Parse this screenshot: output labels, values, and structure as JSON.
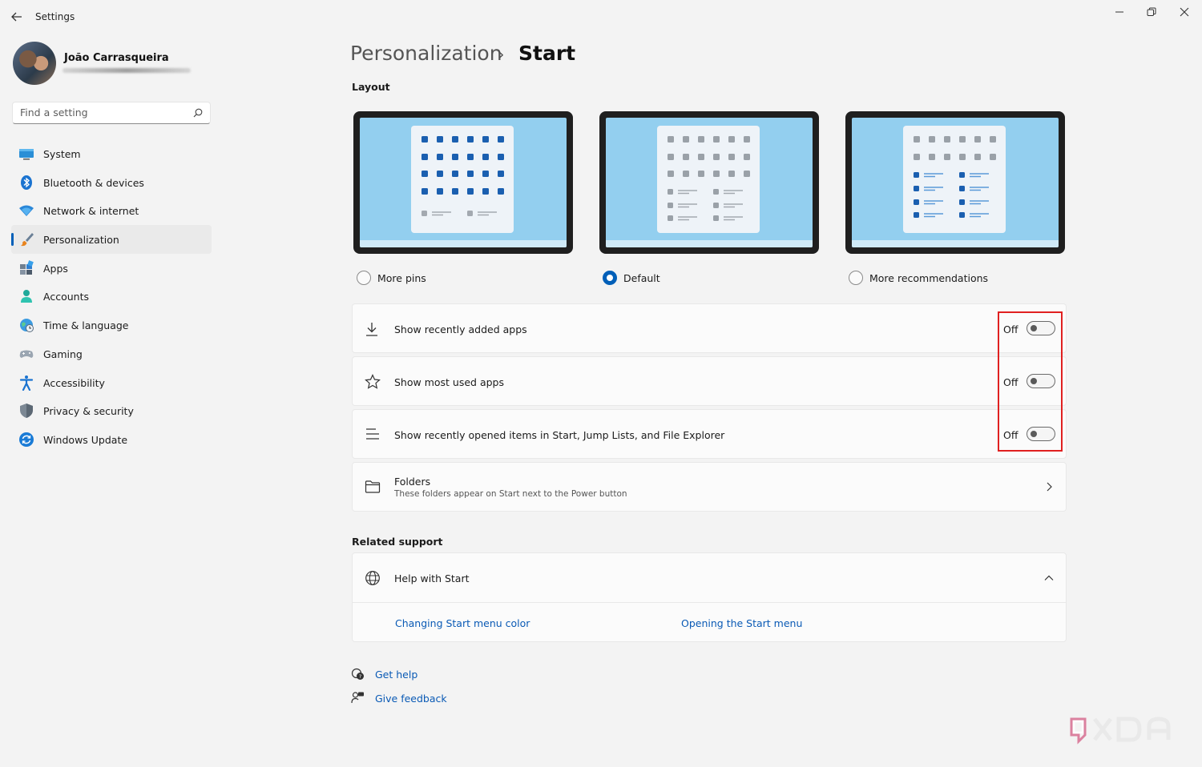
{
  "window": {
    "title": "Settings"
  },
  "user": {
    "name": "João Carrasqueira"
  },
  "search": {
    "placeholder": "Find a setting"
  },
  "sidebar": {
    "items": [
      {
        "label": "System",
        "icon": "system-icon"
      },
      {
        "label": "Bluetooth & devices",
        "icon": "bluetooth-icon"
      },
      {
        "label": "Network & internet",
        "icon": "wifi-icon"
      },
      {
        "label": "Personalization",
        "icon": "brush-icon",
        "active": true
      },
      {
        "label": "Apps",
        "icon": "apps-icon"
      },
      {
        "label": "Accounts",
        "icon": "accounts-icon"
      },
      {
        "label": "Time & language",
        "icon": "globe-clock-icon"
      },
      {
        "label": "Gaming",
        "icon": "gamepad-icon"
      },
      {
        "label": "Accessibility",
        "icon": "accessibility-icon"
      },
      {
        "label": "Privacy & security",
        "icon": "shield-icon"
      },
      {
        "label": "Windows Update",
        "icon": "update-icon"
      }
    ]
  },
  "breadcrumb": {
    "parent": "Personalization",
    "separator": "›",
    "current": "Start"
  },
  "layout": {
    "heading": "Layout",
    "options": [
      {
        "label": "More pins",
        "selected": false
      },
      {
        "label": "Default",
        "selected": true
      },
      {
        "label": "More recommendations",
        "selected": false
      }
    ]
  },
  "settings": {
    "recent_apps": {
      "label": "Show recently added apps",
      "state": "Off",
      "icon": "download-icon"
    },
    "most_used": {
      "label": "Show most used apps",
      "state": "Off",
      "icon": "star-icon"
    },
    "recent_items": {
      "label": "Show recently opened items in Start, Jump Lists, and File Explorer",
      "state": "Off",
      "icon": "list-icon"
    },
    "folders": {
      "label": "Folders",
      "description": "These folders appear on Start next to the Power button",
      "icon": "folder-icon"
    }
  },
  "related_support": {
    "heading": "Related support",
    "help": {
      "label": "Help with Start",
      "icon": "globe-icon"
    },
    "links": [
      "Changing Start menu color",
      "Opening the Start menu"
    ]
  },
  "footer": {
    "get_help": "Get help",
    "give_feedback": "Give feedback"
  },
  "colors": {
    "accent": "#005fb8",
    "highlight_box": "#e02020",
    "link": "#0a5ab5"
  },
  "watermark": "XDA"
}
